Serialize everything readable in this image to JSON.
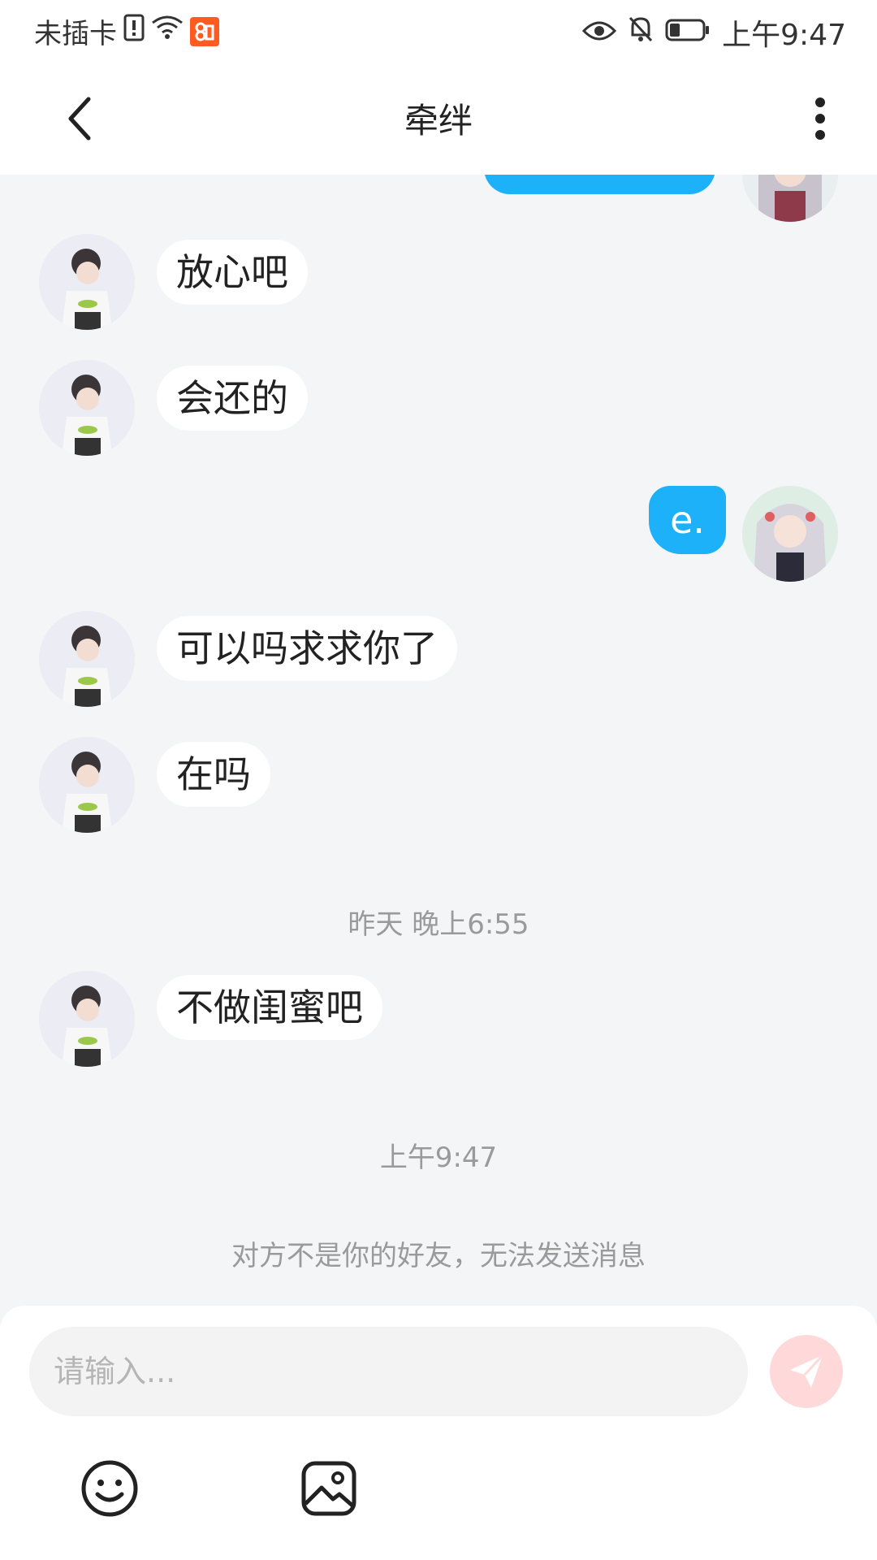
{
  "status_bar": {
    "carrier": "未插卡",
    "time": "上午9:47",
    "icons": [
      "sim-alert-icon",
      "wifi-icon",
      "app-badge-icon",
      "eye-icon",
      "bell-muted-icon",
      "battery-icon"
    ]
  },
  "nav": {
    "title": "牵绊",
    "back_icon": "chevron-left-icon",
    "more_icon": "more-vertical-icon"
  },
  "messages": [
    {
      "side": "left",
      "text": "放心吧"
    },
    {
      "side": "left",
      "text": "会还的"
    },
    {
      "side": "right",
      "text": "e."
    },
    {
      "side": "left",
      "text": "可以吗求求你了"
    },
    {
      "side": "left",
      "text": "在吗"
    },
    {
      "side": "time",
      "text": "昨天 晚上6:55"
    },
    {
      "side": "left",
      "text": "不做闺蜜吧"
    },
    {
      "side": "time",
      "text": "上午9:47"
    }
  ],
  "notice": "对方不是你的好友，无法发送消息",
  "composer": {
    "placeholder": "请输入...",
    "send_icon": "send-icon",
    "emoji_icon": "emoji-icon",
    "image_icon": "image-icon"
  },
  "colors": {
    "my_bubble": "#1cb1f8",
    "send_button": "#ffd9d9",
    "background": "#f4f5f7"
  }
}
